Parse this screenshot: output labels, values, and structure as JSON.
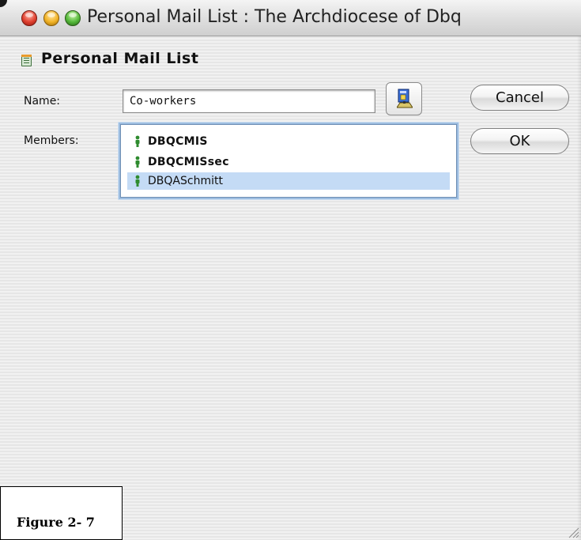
{
  "window": {
    "title": "Personal Mail List : The Archdiocese of Dbq"
  },
  "header": {
    "title": "Personal Mail List",
    "icon": "mail-list-icon"
  },
  "form": {
    "name_label": "Name:",
    "name_value": "Co-workers",
    "members_label": "Members:",
    "address_book_icon": "address-book-icon"
  },
  "members": [
    {
      "name": "DBQCMIS",
      "bold": true,
      "selected": false,
      "icon": "person-icon"
    },
    {
      "name": "DBQCMISsec",
      "bold": true,
      "selected": false,
      "icon": "person-icon"
    },
    {
      "name": "DBQASchmitt",
      "bold": false,
      "selected": true,
      "icon": "person-icon"
    }
  ],
  "buttons": {
    "cancel_label": "Cancel",
    "ok_label": "OK"
  },
  "figure": {
    "label": "Figure 2- 7"
  },
  "colors": {
    "selection": "#c4dbf5",
    "focus_ring": "#9dbde0",
    "person_icon": "#2e8b2e"
  }
}
